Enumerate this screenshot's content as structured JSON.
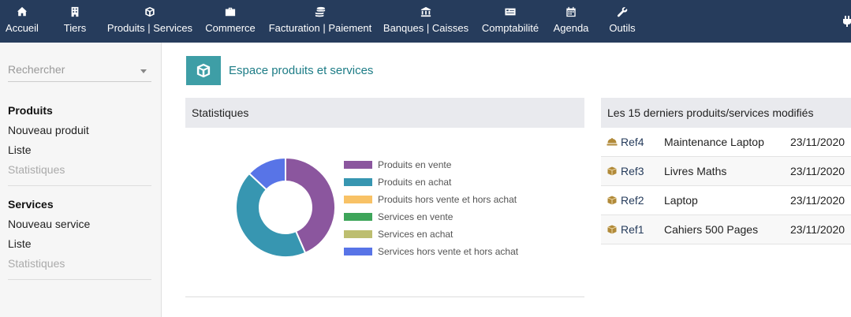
{
  "nav": [
    {
      "label": "Accueil",
      "icon": "home-icon"
    },
    {
      "label": "Tiers",
      "icon": "building-icon"
    },
    {
      "label": "Produits | Services",
      "icon": "cube-icon"
    },
    {
      "label": "Commerce",
      "icon": "briefcase-icon"
    },
    {
      "label": "Facturation | Paiement",
      "icon": "coins-icon"
    },
    {
      "label": "Banques | Caisses",
      "icon": "bank-icon"
    },
    {
      "label": "Comptabilité",
      "icon": "money-check-icon"
    },
    {
      "label": "Agenda",
      "icon": "calendar-icon"
    },
    {
      "label": "Outils",
      "icon": "wrench-icon"
    }
  ],
  "colors": {
    "topbar": "#263c5c",
    "accent": "#3e9ea6"
  },
  "sidebar": {
    "search_placeholder": "Rechercher",
    "groups": [
      {
        "title": "Produits",
        "items": [
          {
            "label": "Nouveau produit",
            "disabled": false
          },
          {
            "label": "Liste",
            "disabled": false
          },
          {
            "label": "Statistiques",
            "disabled": true
          }
        ]
      },
      {
        "title": "Services",
        "items": [
          {
            "label": "Nouveau service",
            "disabled": false
          },
          {
            "label": "Liste",
            "disabled": false
          },
          {
            "label": "Statistiques",
            "disabled": true
          }
        ]
      }
    ]
  },
  "main": {
    "title": "Espace produits et services",
    "stats_title": "Statistiques",
    "recent_title": "Les 15 derniers produits/services modifiés"
  },
  "chart_data": {
    "type": "pie",
    "donut": true,
    "legend_position": "right",
    "series": [
      {
        "name": "Produits en vente",
        "value": 2,
        "color": "#8b569e"
      },
      {
        "name": "Produits en achat",
        "value": 2,
        "color": "#3796b1"
      },
      {
        "name": "Produits hors vente et hors achat",
        "value": 0,
        "color": "#f8c266"
      },
      {
        "name": "Services en vente",
        "value": 0,
        "color": "#3ea55a"
      },
      {
        "name": "Services en achat",
        "value": 0,
        "color": "#bdbe70"
      },
      {
        "name": "Services hors vente et hors achat",
        "value": 0.6,
        "color": "#5874e7"
      }
    ]
  },
  "recent": [
    {
      "ref": "Ref4",
      "label": "Maintenance Laptop",
      "date": "23/11/2020",
      "icon": "service-bell-icon"
    },
    {
      "ref": "Ref3",
      "label": "Livres Maths",
      "date": "23/11/2020",
      "icon": "product-cube-icon"
    },
    {
      "ref": "Ref2",
      "label": "Laptop",
      "date": "23/11/2020",
      "icon": "product-cube-icon"
    },
    {
      "ref": "Ref1",
      "label": "Cahiers 500 Pages",
      "date": "23/11/2020",
      "icon": "product-cube-icon"
    }
  ]
}
